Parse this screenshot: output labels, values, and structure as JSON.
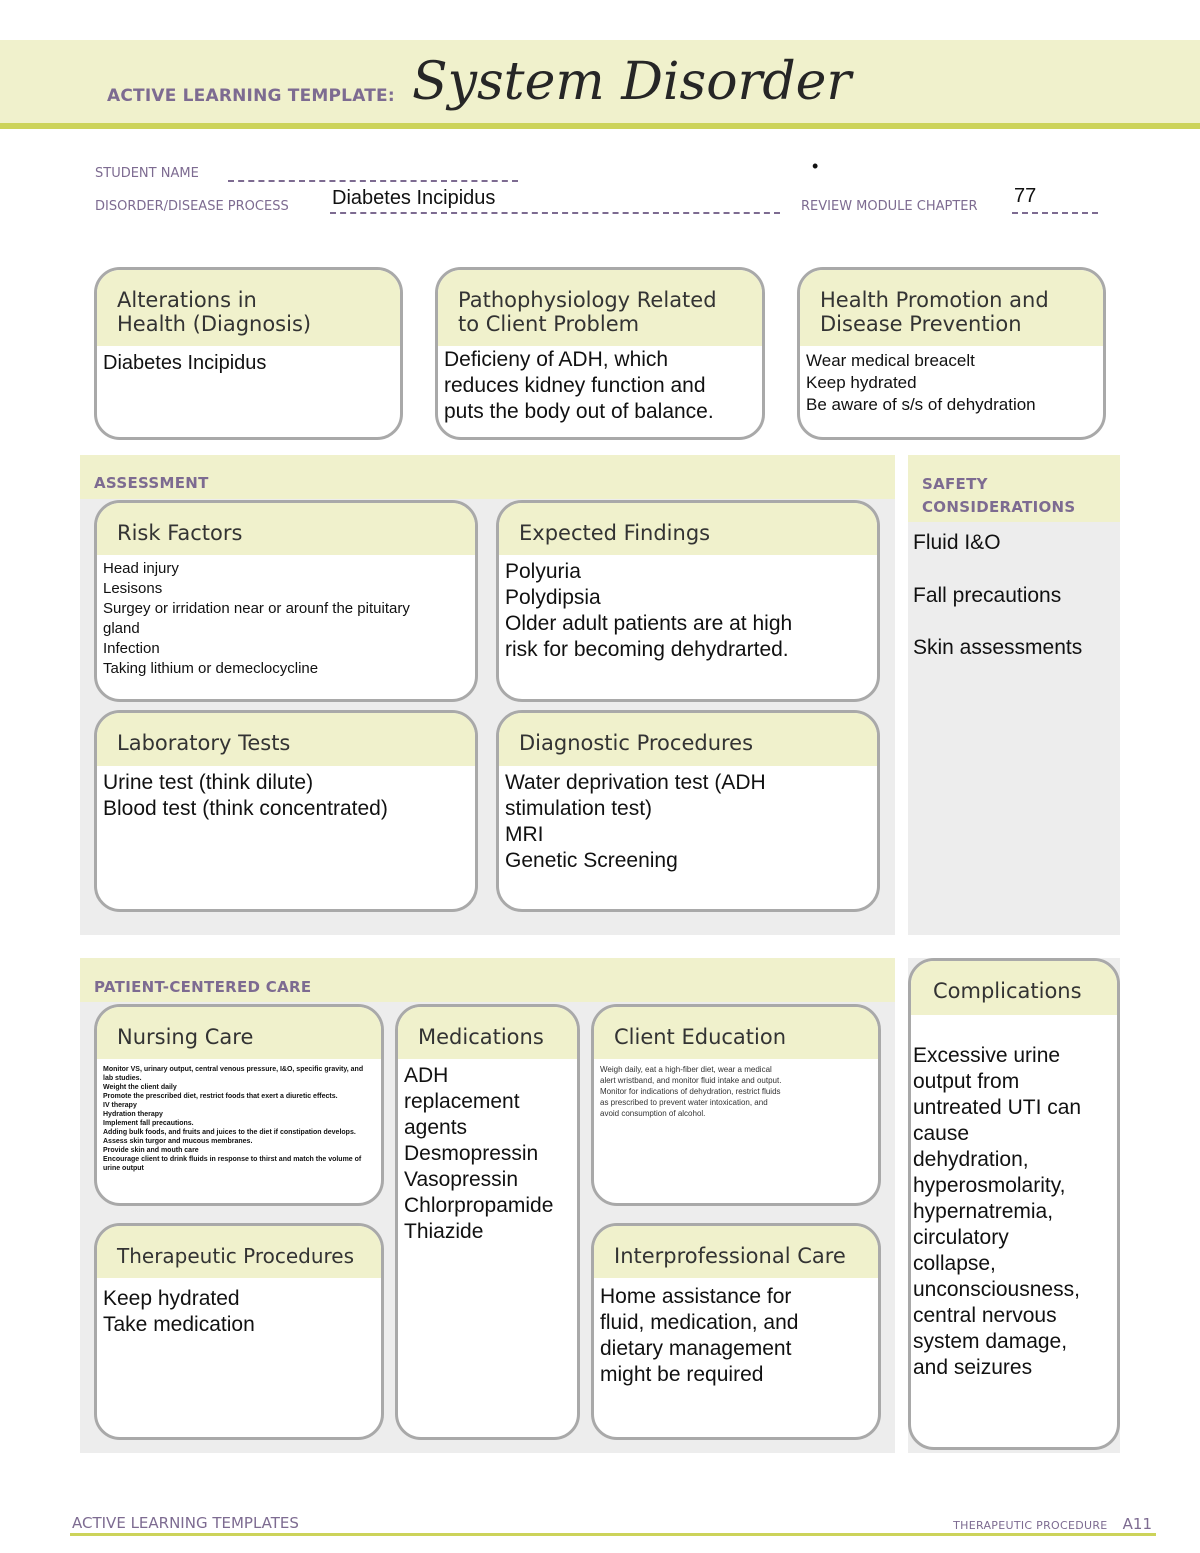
{
  "header": {
    "label": "ACTIVE LEARNING TEMPLATE:",
    "title": "System Disorder"
  },
  "meta": {
    "student_name_label": "STUDENT NAME",
    "student_name_value": "",
    "disorder_label": "DISORDER/DISEASE PROCESS",
    "disorder_value": "Diabetes Incipidus",
    "review_module_label": "REVIEW MODULE CHAPTER",
    "review_module_value": "77",
    "stray_mark": "•"
  },
  "top_cards": [
    {
      "title": "Alterations in\nHealth (Diagnosis)",
      "body": "Diabetes Incipidus"
    },
    {
      "title": "Pathophysiology Related\nto Client Problem",
      "body": "Deficieny of ADH, which\nreduces kidney function and\nputs the body out of balance."
    },
    {
      "title": "Health Promotion and\nDisease Prevention",
      "body": "Wear medical breacelt\nKeep hydrated\nBe aware of s/s of dehydration"
    }
  ],
  "assessment": {
    "label": "ASSESSMENT",
    "cards": [
      {
        "title": "Risk Factors",
        "body": "Head injury\nLesisons\nSurgey or irridation near or arounf the pituitary\ngland\nInfection\nTaking lithium or demeclocycline"
      },
      {
        "title": "Expected Findings",
        "body": "Polyuria\nPolydipsia\nOlder adult patients are at high\nrisk for becoming dehydrarted."
      },
      {
        "title": "Laboratory Tests",
        "body": "Urine test (think dilute)\nBlood test (think concentrated)"
      },
      {
        "title": "Diagnostic Procedures",
        "body": "Water deprivation test (ADH\nstimulation test)\nMRI\nGenetic Screening"
      }
    ]
  },
  "safety": {
    "label": "SAFETY\nCONSIDERATIONS",
    "items": [
      "Fluid I&O",
      "Fall precautions",
      "Skin assessments"
    ]
  },
  "patient_care": {
    "label": "PATIENT-CENTERED CARE",
    "nursing_care": {
      "title": "Nursing Care",
      "body": "Monitor VS, urinary output, central venous pressure, I&O, specific gravity, and lab studies.\nWeight the client daily\nPromote the prescribed diet, restrict foods that exert a diuretic effects.\nIV therapy\nHydration therapy\nImplement fall precautions.\nAdding bulk foods, and fruits and juices to the diet if constipation develops.\nAssess skin turgor and mucous membranes.\nProvide skin and mouth care\nEncourage client to drink fluids in response to thirst and match the volume of urine output"
    },
    "medications": {
      "title": "Medications",
      "body": "ADH\nreplacement\nagents\nDesmopressin\nVasopressin\nChlorpropamide\nThiazide"
    },
    "client_education": {
      "title": "Client Education",
      "body": " Weigh daily, eat a high-fiber diet, wear a medical\nalert wristband, and monitor fluid intake and output.\n Monitor for indications of dehydration, restrict fluids\nas prescribed to prevent water intoxication, and\navoid consumption of alcohol."
    },
    "therapeutic_procedures": {
      "title": "Therapeutic Procedures",
      "body": "Keep hydrated\nTake medication"
    },
    "interprofessional_care": {
      "title": "Interprofessional Care",
      "body": " Home assistance for\nfluid, medication, and\ndietary management\nmight be required"
    }
  },
  "complications": {
    "title": "Complications",
    "body": " Excessive urine\noutput from\nuntreated UTI can\ncause\ndehydration,\nhyperosmolarity,\nhypernatremia,\ncirculatory\ncollapse,\nunconsciousness,\ncentral nervous\nsystem damage,\nand seizures"
  },
  "footer": {
    "left": "ACTIVE LEARNING TEMPLATES",
    "right_label": "THERAPEUTIC PROCEDURE",
    "page": "A11"
  },
  "colors": {
    "accent_band": "#f0f1cc",
    "accent_rule": "#ccd35a",
    "label_purple": "#7d6b91",
    "panel_gray": "#ededed",
    "card_border": "#a9a9a9"
  }
}
